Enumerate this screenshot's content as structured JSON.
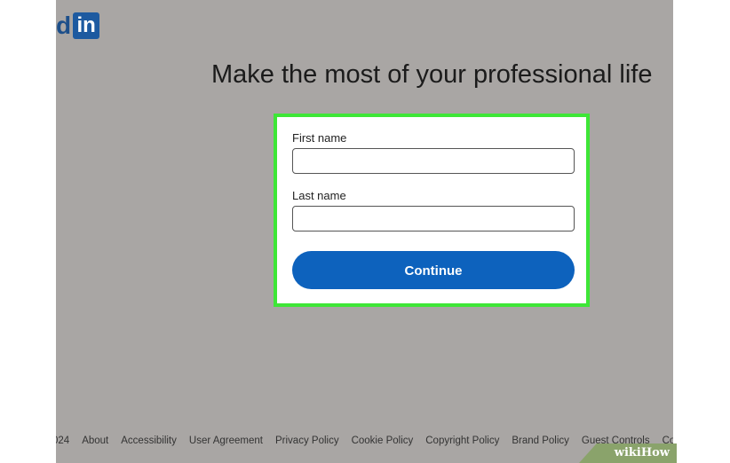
{
  "logo": {
    "partial_text": "d",
    "badge": "in"
  },
  "headline": "Make the most of your professional life",
  "form": {
    "first_name_label": "First name",
    "first_name_value": "",
    "last_name_label": "Last name",
    "last_name_value": "",
    "continue_label": "Continue"
  },
  "footer": [
    "024",
    "About",
    "Accessibility",
    "User Agreement",
    "Privacy Policy",
    "Cookie Policy",
    "Copyright Policy",
    "Brand Policy",
    "Guest Controls",
    "Commu"
  ],
  "watermark": {
    "prefix": "wiki",
    "suffix": "How"
  },
  "colors": {
    "highlight": "#3ee637",
    "button": "#0d62bd"
  }
}
